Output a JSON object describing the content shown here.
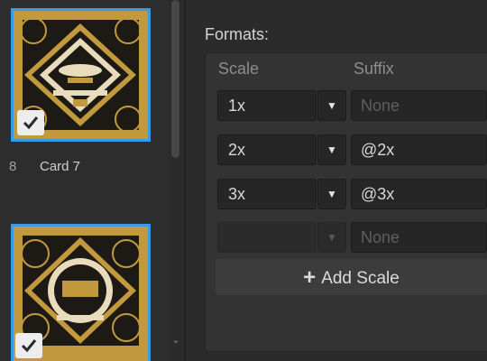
{
  "cards": [
    {
      "number": "8",
      "name": "Card 7",
      "selected": true
    },
    {
      "number": "",
      "name": "",
      "selected": true
    }
  ],
  "formats": {
    "label": "Formats:",
    "columns": {
      "scale": "Scale",
      "suffix": "Suffix"
    },
    "rows": [
      {
        "scale": "1x",
        "suffix": "",
        "suffix_placeholder": "None",
        "enabled": true
      },
      {
        "scale": "2x",
        "suffix": "@2x",
        "suffix_placeholder": "",
        "enabled": true
      },
      {
        "scale": "3x",
        "suffix": "@3x",
        "suffix_placeholder": "",
        "enabled": true
      },
      {
        "scale": "",
        "suffix": "",
        "suffix_placeholder": "None",
        "enabled": false
      }
    ],
    "add_button_label": "Add Scale",
    "add_button_icon": "+"
  },
  "icons": {
    "dropdown": "dropdown-triangle-icon",
    "check": "check-icon",
    "scroll_down": "chevron-down-icon"
  },
  "colors": {
    "selection": "#3b99e8",
    "card_gold": "#c2993c",
    "card_dark": "#1d1a16"
  }
}
